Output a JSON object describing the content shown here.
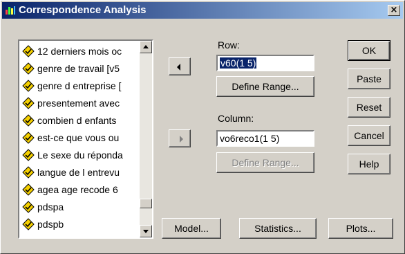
{
  "window": {
    "title": "Correspondence Analysis",
    "close_label": "×"
  },
  "variables": [
    "12 derniers mois oc",
    "genre de travail [v5",
    "genre d entreprise [",
    "presentement avec",
    "combien d enfants",
    "est-ce que vous ou",
    "Le sexe du réponda",
    "langue de l entrevu",
    "agea age recode 6",
    "pdspa",
    "pdspb"
  ],
  "row": {
    "label": "Row:",
    "value": "v60(1 5)",
    "define_range_label": "Define Range..."
  },
  "column": {
    "label": "Column:",
    "value": "vo6reco1(1 5)",
    "define_range_label": "Define Range..."
  },
  "buttons": {
    "ok": "OK",
    "paste": "Paste",
    "reset": "Reset",
    "cancel": "Cancel",
    "help": "Help",
    "model": "Model...",
    "statistics": "Statistics...",
    "plots": "Plots..."
  },
  "colors": {
    "titlebar_start": "#0a246a",
    "titlebar_end": "#a6caf0",
    "selection": "#0a246a",
    "var_icon": "#f5d000"
  }
}
